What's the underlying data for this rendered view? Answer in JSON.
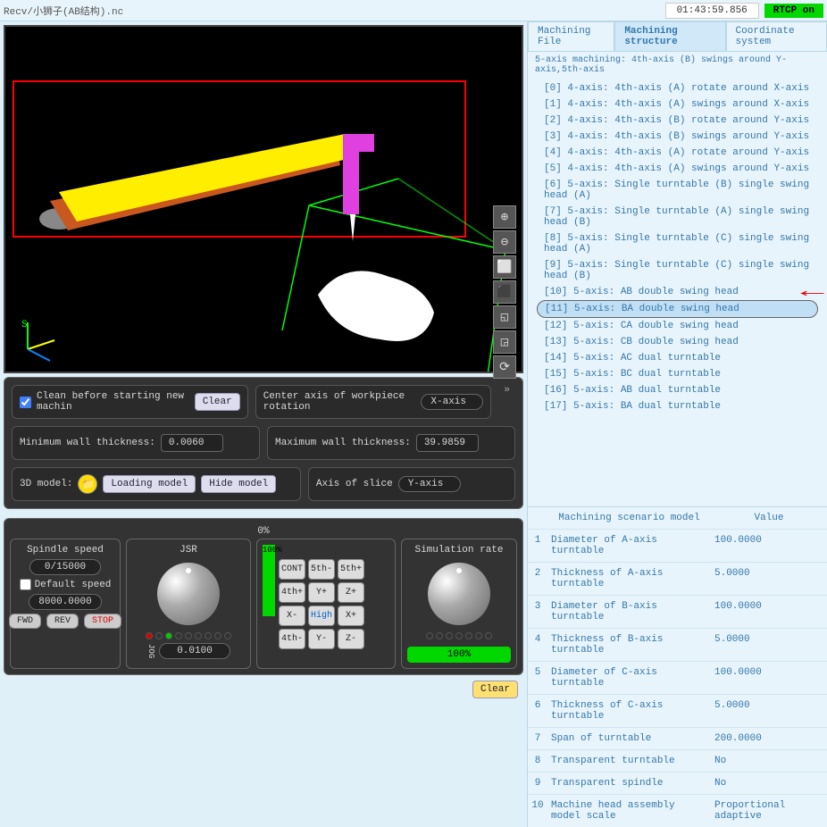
{
  "title_bar": {
    "path": "Recv/小狮子(AB结构).nc",
    "time": "01:43:59.856",
    "rtcp": "RTCP on"
  },
  "viewport": {
    "tools": [
      "⊕",
      "⊖",
      "⬜",
      "⬛",
      "◱",
      "◲",
      "⟳"
    ]
  },
  "params": {
    "clean_label": "Clean before starting new machin",
    "clear_btn": "Clear",
    "center_axis_label": "Center axis of workpiece rotation",
    "center_axis_val": "X-axis",
    "min_wall_label": "Minimum wall thickness:",
    "min_wall_val": "0.0060",
    "max_wall_label": "Maximum wall thickness:",
    "max_wall_val": "39.9859",
    "model3d_label": "3D model:",
    "loading_btn": "Loading model",
    "hide_btn": "Hide model",
    "slice_label": "Axis of slice",
    "slice_val": "Y-axis"
  },
  "progress": {
    "pct": "0%"
  },
  "spindle": {
    "title": "Spindle speed",
    "cur": "0/15000",
    "default_label": "Default speed",
    "default_val": "8000.0000",
    "fwd": "FWD",
    "rev": "REV",
    "stop": "STOP"
  },
  "jsr": {
    "title": "JSR",
    "meter": "100%",
    "jog_label": "JOG",
    "jog_val": "0.0100"
  },
  "keypad": {
    "keys": [
      "CONT",
      "5th-",
      "5th+",
      "4th+",
      "Y+",
      "Z+",
      "X-",
      "High",
      "X+",
      "4th-",
      "Y-",
      "Z-"
    ]
  },
  "sim": {
    "title": "Simulation rate",
    "pct": "100%"
  },
  "bottom": {
    "clear": "Clear"
  },
  "tabs": {
    "t1": "Machining File",
    "t2": "Machining structure",
    "t3": "Coordinate system"
  },
  "summary": "5-axis machining: 4th-axis (B) swings around Y-axis,5th-axis",
  "structures": [
    "[0] 4-axis: 4th-axis (A) rotate around X-axis",
    "[1] 4-axis: 4th-axis (A) swings around X-axis",
    "[2] 4-axis: 4th-axis (B) rotate around Y-axis",
    "[3] 4-axis: 4th-axis (B) swings around Y-axis",
    "[4] 4-axis: 4th-axis (A) rotate around Y-axis",
    "[5] 4-axis: 4th-axis (A) swings around Y-axis",
    "[6] 5-axis: Single turntable (B) single swing head (A)",
    "[7] 5-axis: Single turntable (A) single swing head (B)",
    "[8] 5-axis: Single turntable (C) single swing head (A)",
    "[9] 5-axis: Single turntable (C) single swing head (B)",
    "[10] 5-axis: AB double swing head",
    "[11] 5-axis: BA double swing head",
    "[12] 5-axis: CA double swing head",
    "[13] 5-axis: CB double swing head",
    "[14] 5-axis: AC dual turntable",
    "[15] 5-axis: BC dual turntable",
    "[16] 5-axis: AB dual turntable",
    "[17] 5-axis: BA dual turntable"
  ],
  "selected_structure": 11,
  "model_table": {
    "head_name": "Machining scenario model",
    "head_val": "Value",
    "rows": [
      {
        "i": "1",
        "n": "Diameter of A-axis turntable",
        "v": "100.0000"
      },
      {
        "i": "2",
        "n": "Thickness of A-axis turntable",
        "v": "5.0000"
      },
      {
        "i": "3",
        "n": "Diameter of B-axis turntable",
        "v": "100.0000"
      },
      {
        "i": "4",
        "n": "Thickness of B-axis turntable",
        "v": "5.0000"
      },
      {
        "i": "5",
        "n": "Diameter of C-axis turntable",
        "v": "100.0000"
      },
      {
        "i": "6",
        "n": "Thickness of C-axis turntable",
        "v": "5.0000"
      },
      {
        "i": "7",
        "n": "Span of turntable",
        "v": "200.0000"
      },
      {
        "i": "8",
        "n": "Transparent turntable",
        "v": "No"
      },
      {
        "i": "9",
        "n": "Transparent spindle",
        "v": "No"
      },
      {
        "i": "10",
        "n": "Machine head assembly model scale",
        "v": "Proportional adaptive"
      }
    ]
  }
}
